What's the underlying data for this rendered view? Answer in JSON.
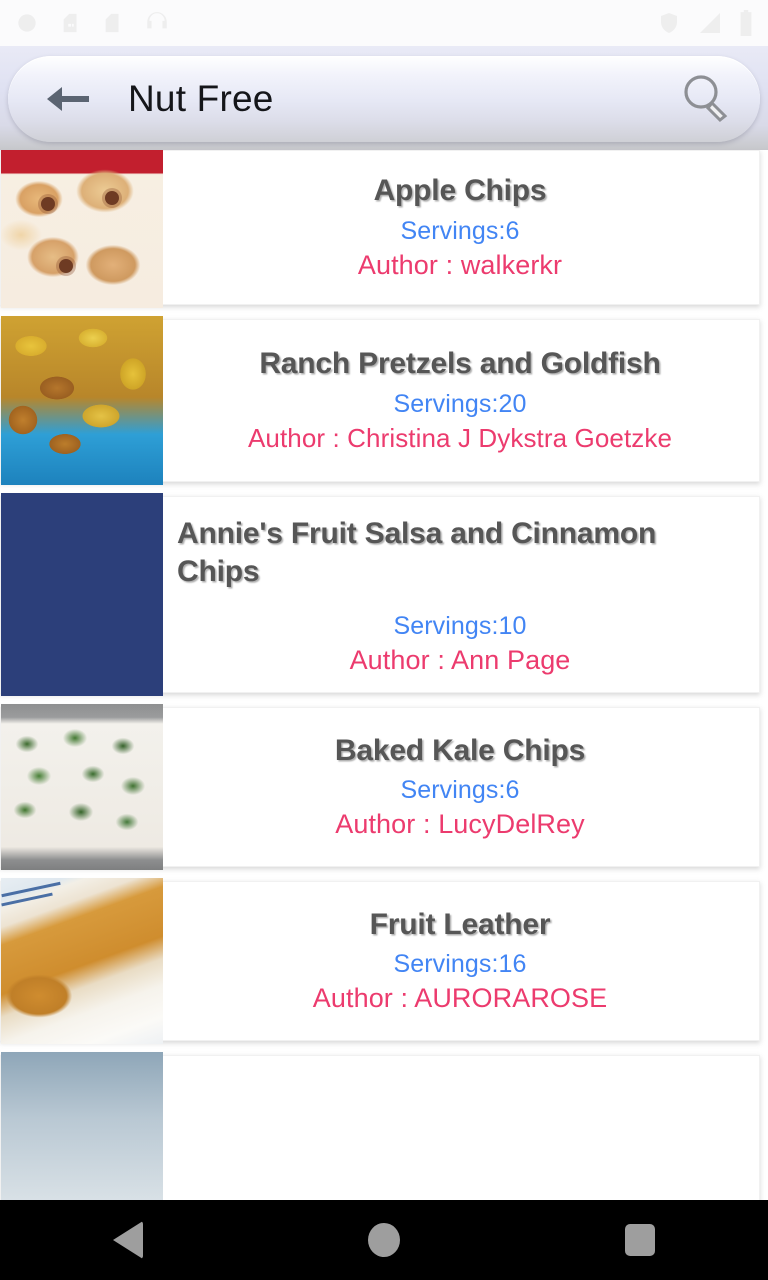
{
  "status_bar": {
    "left_icons": [
      "alarm-icon",
      "sim-card-icon",
      "sd-card-icon",
      "headset-icon"
    ],
    "right_icons": [
      "shield-icon",
      "signal-icon",
      "battery-icon"
    ]
  },
  "search": {
    "back_icon": "back-arrow-icon",
    "query": "Nut Free",
    "placeholder": "Search",
    "search_icon": "magnifier-icon"
  },
  "theme": {
    "title_color": "#565656",
    "servings_color": "#4285f4",
    "author_color": "#ec3b6e",
    "card_background": "#ffffff",
    "page_background": "#ffffff",
    "navbar_background": "#000000"
  },
  "labels": {
    "servings_prefix": "Servings:",
    "author_prefix": "Author : "
  },
  "recipes": [
    {
      "title": "Apple Chips",
      "servings": "Servings:6",
      "author": "Author : walkerkr",
      "image": "apple-chips-photo"
    },
    {
      "title": "Ranch Pretzels and Goldfish",
      "servings": "Servings:20",
      "author": "Author : Christina J Dykstra Goetzke",
      "image": "ranch-pretzels-goldfish-photo"
    },
    {
      "title": "Annie's Fruit Salsa and Cinnamon Chips",
      "servings": "Servings:10",
      "author": "Author : Ann Page",
      "image": "fruit-salsa-cinnamon-chips-photo"
    },
    {
      "title": "Baked Kale Chips",
      "servings": "Servings:6",
      "author": "Author : LucyDelRey",
      "image": "baked-kale-chips-photo"
    },
    {
      "title": "Fruit Leather",
      "servings": "Servings:16",
      "author": "Author : AURORAROSE",
      "image": "fruit-leather-photo"
    }
  ],
  "navbar": {
    "back_label": "Back",
    "home_label": "Home",
    "recents_label": "Recents"
  }
}
